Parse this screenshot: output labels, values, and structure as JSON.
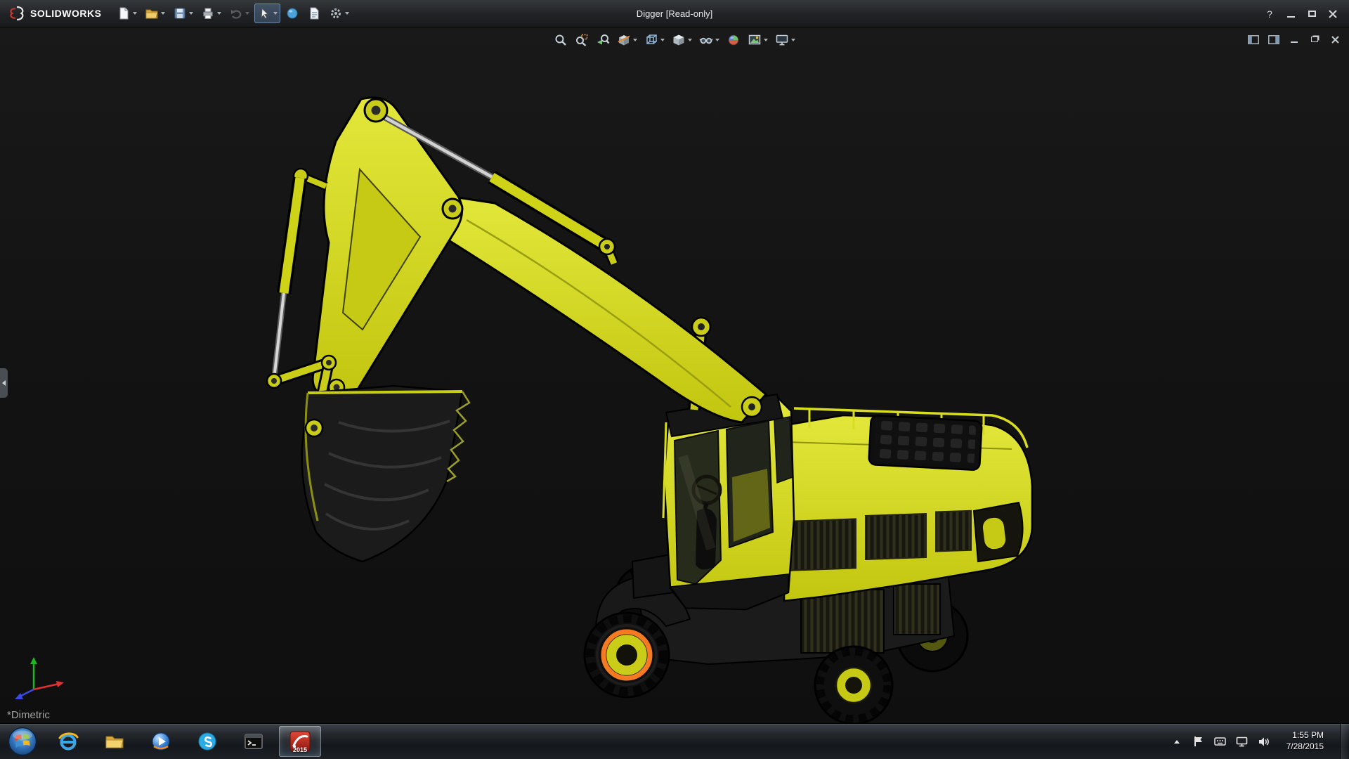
{
  "window": {
    "title": "Digger [Read-only]",
    "help_glyph": "?"
  },
  "brand": {
    "name": "SOLIDWORKS"
  },
  "main_toolbar": {
    "buttons": [
      "new-document",
      "open-document",
      "save",
      "print",
      "undo",
      "select",
      "rebuild",
      "file-properties",
      "options"
    ],
    "active_button": "select",
    "disabled_button": "undo"
  },
  "headsup_toolbar": {
    "buttons": [
      "zoom-to-fit",
      "zoom-to-area",
      "previous-view",
      "section-view",
      "view-orientation",
      "display-style",
      "hide-show-items",
      "edit-appearance",
      "apply-scene",
      "view-settings"
    ]
  },
  "document_controls": [
    "show-pane-left",
    "show-pane-right",
    "minimize-document",
    "restore-document",
    "close-document"
  ],
  "viewport": {
    "orientation_label": "*Dimetric",
    "model_color": "#d6d91c",
    "background_color": "#131313",
    "selection": {
      "component": "front-wheel",
      "highlight_color": "#f57a22"
    },
    "triad_colors": {
      "x": "#e03232",
      "y": "#1fb51f",
      "z": "#3a4ae0"
    }
  },
  "taskbar": {
    "start": "start-button",
    "apps": [
      "internet-explorer",
      "windows-explorer",
      "media-player",
      "skype",
      "command-prompt",
      "solidworks"
    ],
    "active_app": "solidworks",
    "solidworks_badge": "2015",
    "tray_icons": [
      "show-hidden-icons",
      "action-center-flag",
      "input-indicator",
      "display",
      "volume"
    ],
    "clock": {
      "time": "1:55 PM",
      "date": "7/28/2015"
    }
  }
}
